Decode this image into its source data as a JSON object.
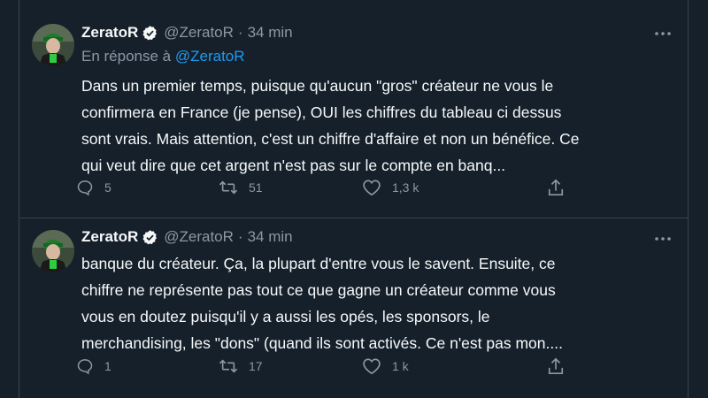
{
  "tweets": [
    {
      "author_name": "ZeratoR",
      "handle": "@ZeratoR",
      "separator": "·",
      "time": "34 min",
      "reply_prefix": "En réponse à",
      "reply_to": "@ZeratoR",
      "text": "Dans un premier temps, puisque qu'aucun \"gros\" créateur ne vous le confirmera en France (je pense), OUI les chiffres du tableau ci dessus sont vrais. Mais attention, c'est un chiffre d'affaire et non un bénéfice. Ce qui veut dire que cet argent n'est pas sur le compte en banq...",
      "replies": "5",
      "retweets": "51",
      "likes": "1,3 k"
    },
    {
      "author_name": "ZeratoR",
      "handle": "@ZeratoR",
      "separator": "·",
      "time": "34 min",
      "text": "banque du créateur. Ça, la plupart d'entre vous le savent. Ensuite, ce chiffre ne représente pas tout ce que gagne un créateur comme vous vous en doutez puisqu'il y a aussi les opés, les sponsors, le merchandising, les \"dons\" (quand ils sont activés. Ce n'est pas mon....",
      "replies": "1",
      "retweets": "17",
      "likes": "1 k"
    }
  ],
  "icons": {
    "verified": "verified-badge-icon",
    "more": "more-options-icon",
    "reply": "reply-icon",
    "retweet": "retweet-icon",
    "like": "heart-icon",
    "share": "share-icon"
  },
  "colors": {
    "background": "#15202b",
    "text": "#f7f9f9",
    "muted": "#8b98a5",
    "accent": "#1d9bf0",
    "border": "#38444d"
  }
}
